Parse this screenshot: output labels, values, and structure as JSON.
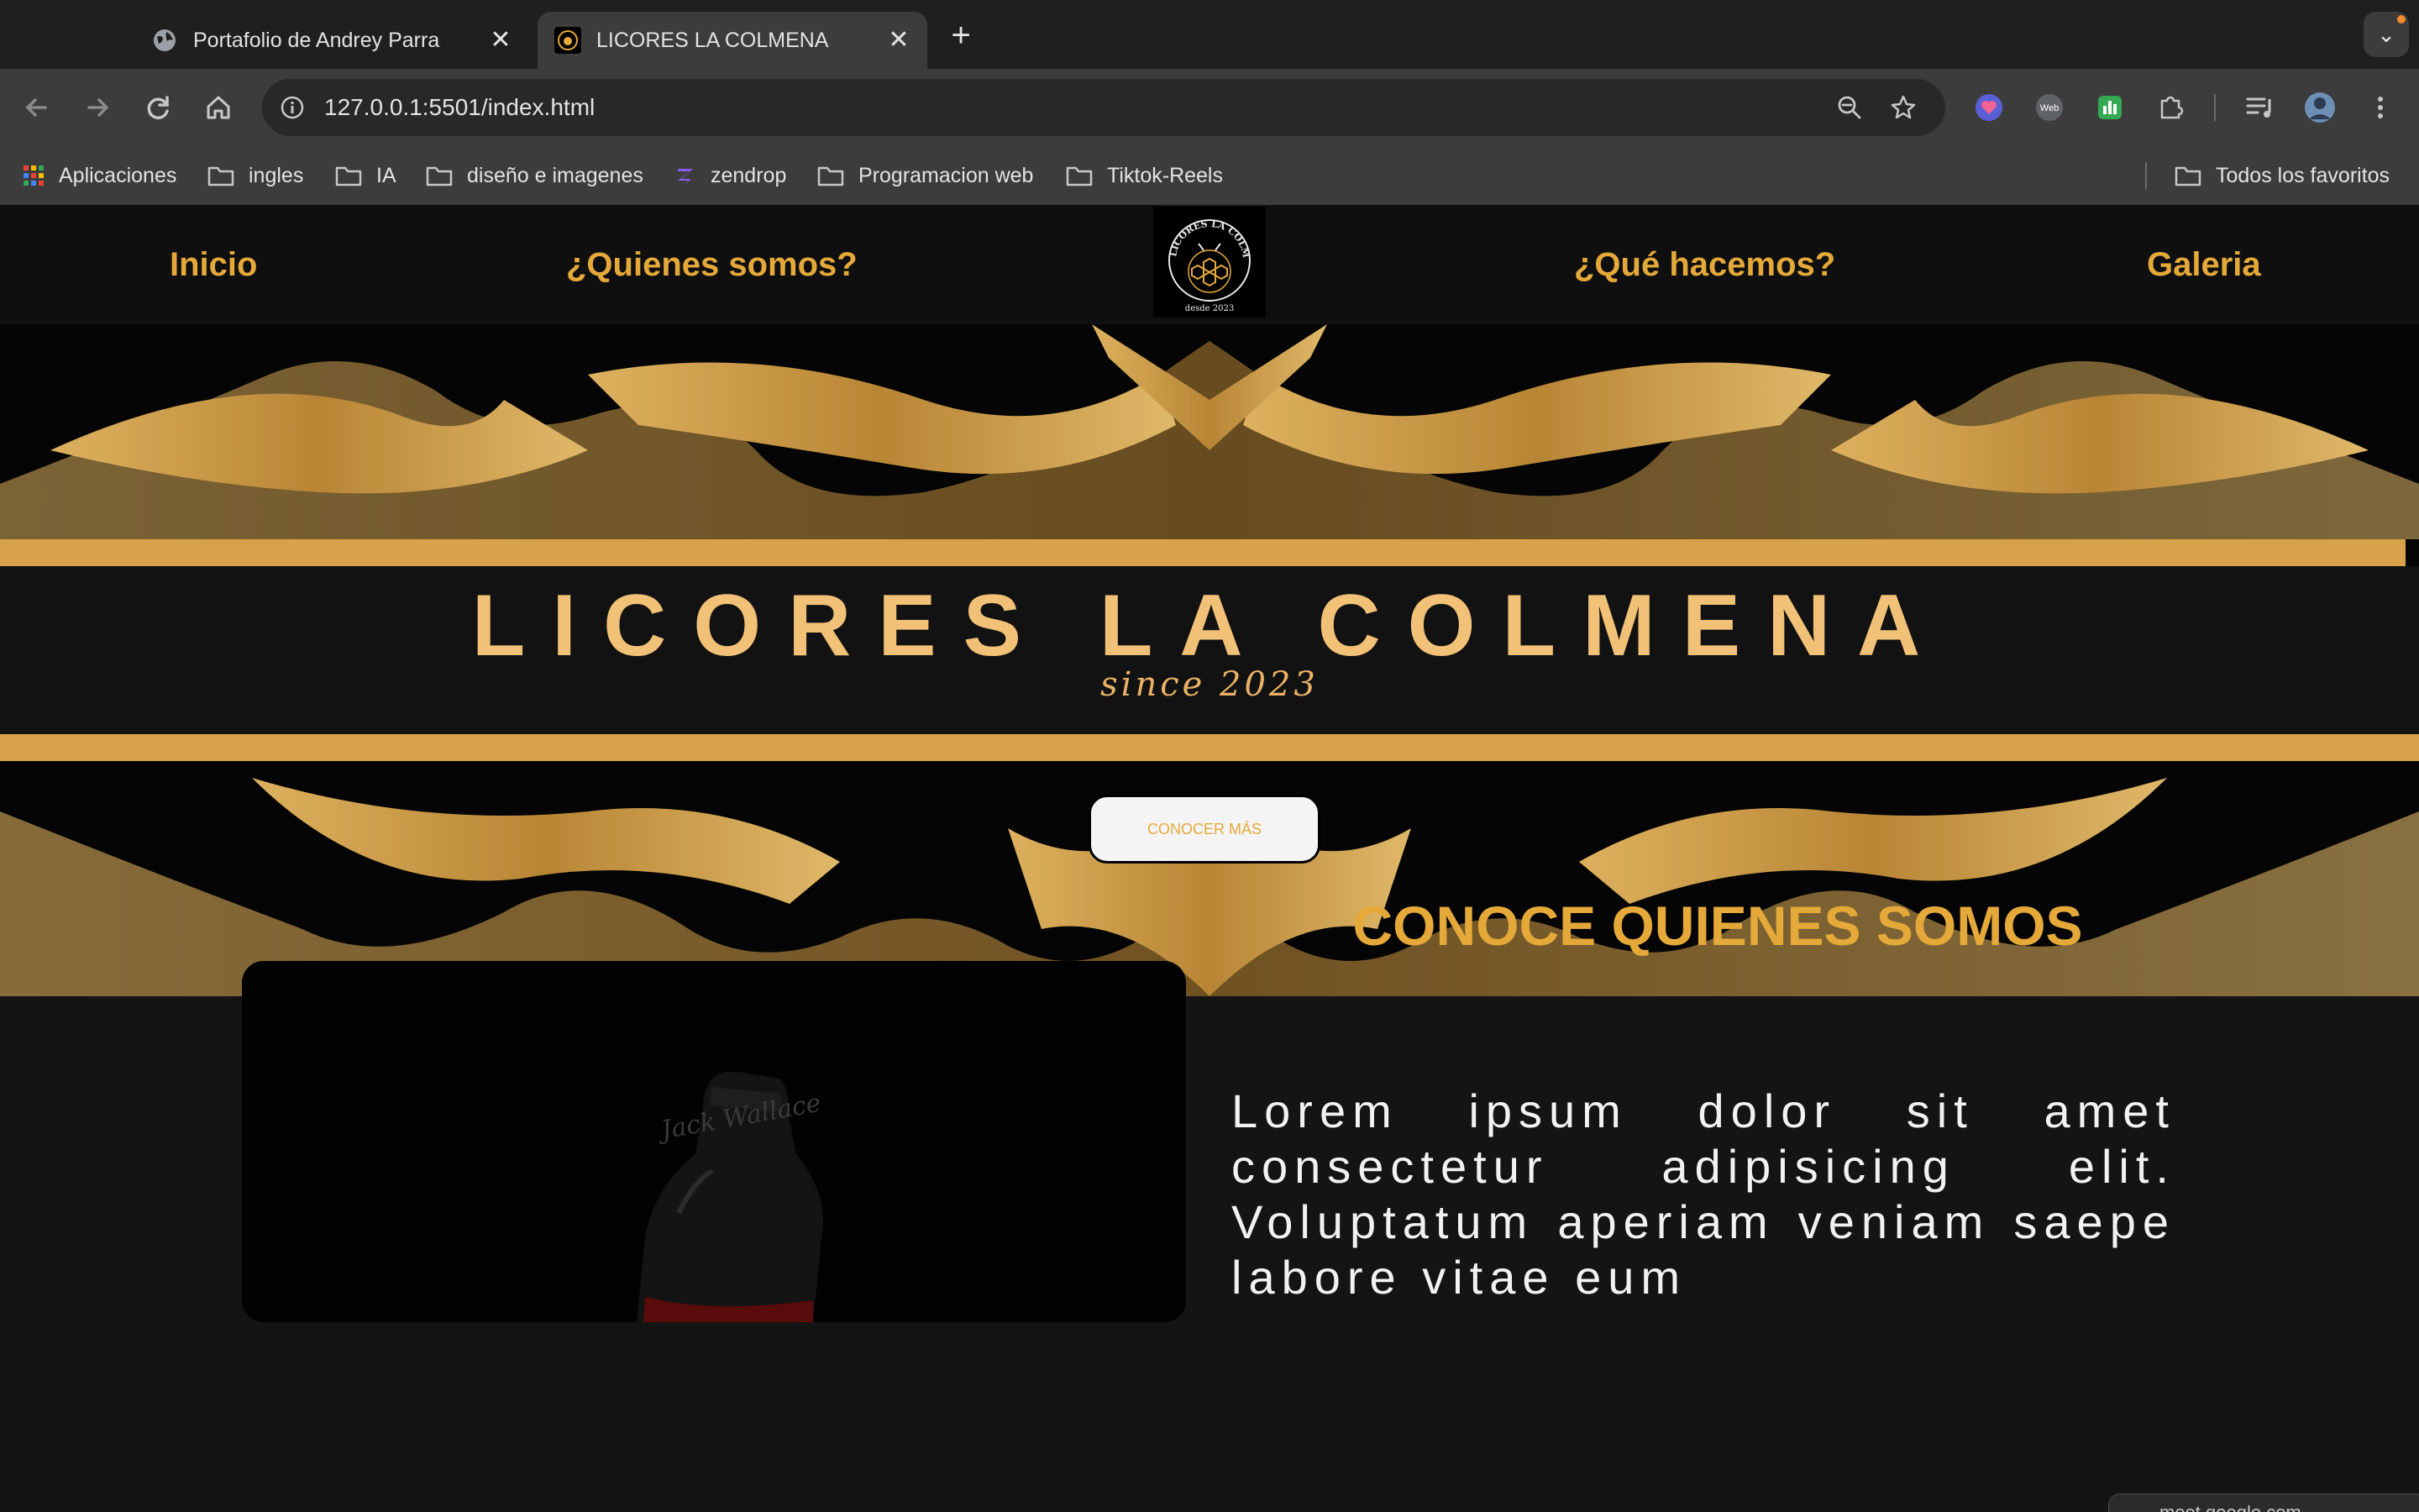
{
  "browser": {
    "tabs": [
      {
        "title": "Portafolio de Andrey Parra",
        "active": false
      },
      {
        "title": "LICORES LA COLMENA",
        "active": true
      }
    ],
    "url": "127.0.0.1:5501/index.html",
    "bookmarks": [
      {
        "label": "Aplicaciones",
        "icon": "apps-grid-icon"
      },
      {
        "label": "ingles",
        "icon": "folder-icon"
      },
      {
        "label": "IA",
        "icon": "folder-icon"
      },
      {
        "label": "diseño e imagenes",
        "icon": "folder-icon"
      },
      {
        "label": "zendrop",
        "icon": "zendrop-icon"
      },
      {
        "label": "Programacion web",
        "icon": "folder-icon"
      },
      {
        "label": "Tiktok-Reels",
        "icon": "folder-icon"
      },
      {
        "label": "Todos los favoritos",
        "icon": "folder-icon"
      }
    ]
  },
  "site": {
    "nav": {
      "inicio": "Inicio",
      "quienes": "¿Quienes somos?",
      "hacemos": "¿Qué hacemos?",
      "galeria": "Galeria"
    },
    "logo_text": "LICORES LA COLMENA",
    "logo_sub": "desde 2023",
    "hero": {
      "title": "LICORES LA COLMENA",
      "subtitle": "since 2023",
      "cta": "CONOCER MÁS"
    },
    "about": {
      "title": "CONOCE QUIENES SOMOS",
      "text": "Lorem ipsum dolor sit amet consectetur adipisicing elit. Voluptatum aperiam veniam saepe labore vitae eum",
      "bottle_label": "Jack Wallace"
    }
  },
  "toast": {
    "text": "meet.google.com"
  },
  "colors": {
    "gold": "#e5a93a",
    "band": "#d8a24a",
    "title": "#f2c178"
  }
}
